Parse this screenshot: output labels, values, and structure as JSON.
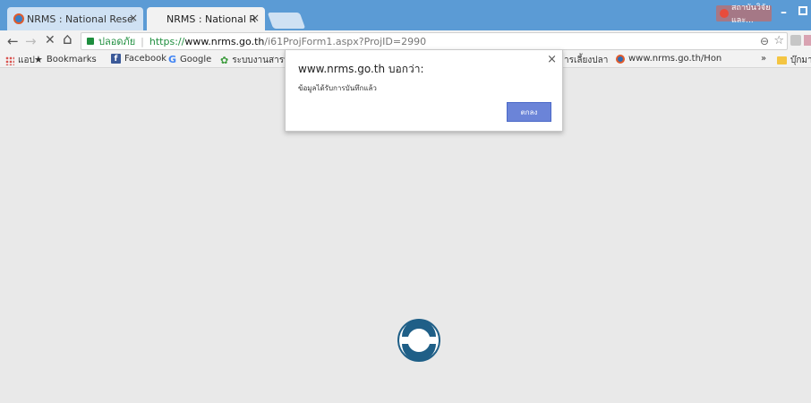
{
  "browser": {
    "tabs": [
      {
        "title": "NRMS : National Researc",
        "close": "×"
      },
      {
        "title": "NRMS : National Researc",
        "close": "×"
      }
    ],
    "profile_label": "สถาบันวิจัยและ...",
    "window_min": "–"
  },
  "toolbar": {
    "back": "←",
    "forward": "→",
    "stop": "✕",
    "home": "⌂",
    "secure_label": "ปลอดภัย",
    "url_separator": "|",
    "url_scheme": "https://",
    "url_host": "www.nrms.go.th",
    "url_path": "/i61ProjForm1.aspx?ProjID=2990",
    "zoom": "⊖",
    "star": "☆"
  },
  "bookmarks": {
    "apps": "แอป",
    "bookmarks_label": "Bookmarks",
    "facebook": "Facebook",
    "google": "Google",
    "saraban": "ระบบงานสารบรรณ",
    "partial": "ารเลี้ยงปลา",
    "nrms_home": "www.nrms.go.th/Hon",
    "overflow": "»",
    "other": "บุ๊กมา"
  },
  "dialog": {
    "title": "www.nrms.go.th บอกว่า:",
    "close": "×",
    "message": "ข้อมูลได้รับการบันทึกแล้ว",
    "ok_label": "ตกลง"
  },
  "colors": {
    "titlebar": "#5b9bd5",
    "ok_button": "#6b84d8",
    "spinner": "#1f5f87"
  }
}
